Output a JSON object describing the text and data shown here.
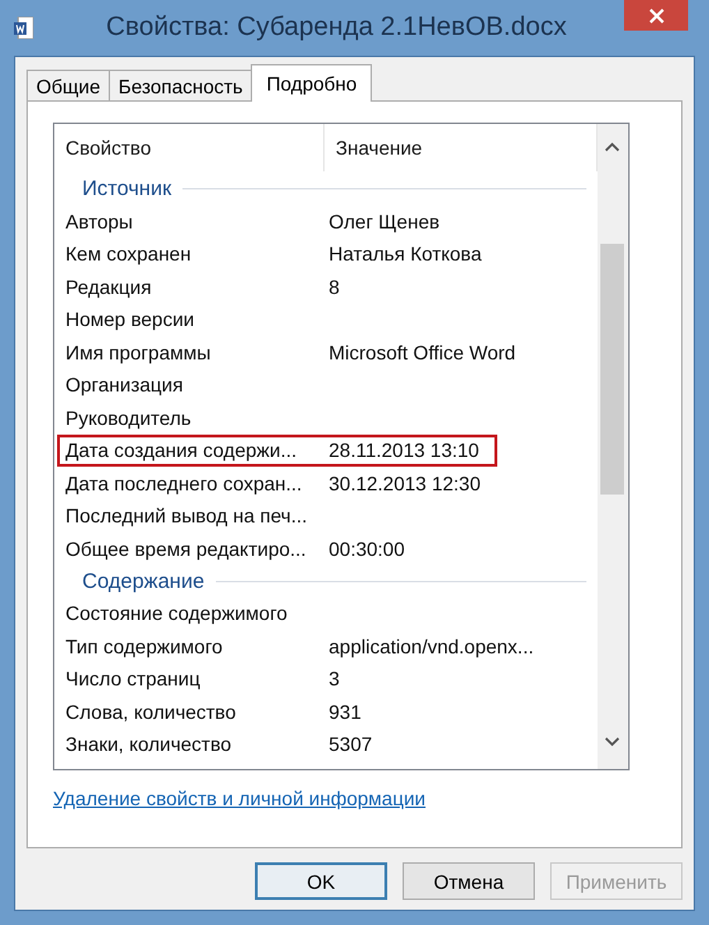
{
  "window": {
    "title": "Свойства: Субаренда 2.1НевОВ.docx"
  },
  "tabs": [
    {
      "label": "Общие",
      "selected": false
    },
    {
      "label": "Безопасность",
      "selected": false
    },
    {
      "label": "Подробно",
      "selected": true
    }
  ],
  "columns": [
    "Свойство",
    "Значение"
  ],
  "groups": [
    {
      "heading": "Источник",
      "rows": [
        {
          "property": "Авторы",
          "value": "Олег Щенев",
          "highlighted": false
        },
        {
          "property": "Кем сохранен",
          "value": "Наталья Коткова",
          "highlighted": false
        },
        {
          "property": "Редакция",
          "value": "8",
          "highlighted": false
        },
        {
          "property": "Номер версии",
          "highlighted": false
        },
        {
          "property": "Имя программы",
          "value": "Microsoft Office Word",
          "highlighted": false
        },
        {
          "property": "Организация",
          "highlighted": false
        },
        {
          "property": "Руководитель",
          "highlighted": false
        },
        {
          "property": "Дата создания содержи...",
          "value": "28.11.2013 13:10",
          "highlighted": true
        },
        {
          "property": "Дата последнего сохран...",
          "value": "30.12.2013 12:30",
          "highlighted": false
        },
        {
          "property": "Последний вывод на печ...",
          "highlighted": false
        },
        {
          "property": "Общее время редактиро...",
          "value": "00:30:00",
          "highlighted": false
        }
      ]
    },
    {
      "heading": "Содержание",
      "rows": [
        {
          "property": "Состояние содержимого",
          "highlighted": false
        },
        {
          "property": "Тип содержимого",
          "value": "application/vnd.openx...",
          "highlighted": false
        },
        {
          "property": "Число страниц",
          "value": "3",
          "highlighted": false
        },
        {
          "property": "Слова, количество",
          "value": "931",
          "highlighted": false
        },
        {
          "property": "Знаки, количество",
          "value": "5307",
          "highlighted": false
        }
      ]
    }
  ],
  "link": "Удаление свойств и личной информации",
  "buttons": [
    {
      "label": "OK",
      "kind": "default",
      "disabled": false
    },
    {
      "label": "Отмена",
      "kind": "normal",
      "disabled": false
    },
    {
      "label": "Применить",
      "kind": "normal",
      "disabled": true
    }
  ]
}
